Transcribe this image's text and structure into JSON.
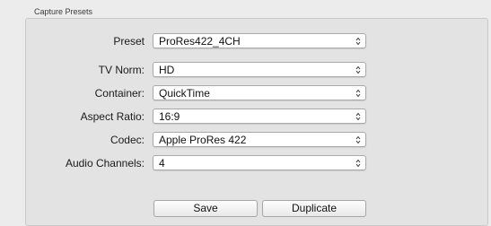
{
  "group_title": "Capture Presets",
  "fields": [
    {
      "label": "Preset",
      "value": "ProRes422_4CH"
    },
    {
      "label": "TV Norm:",
      "value": "HD"
    },
    {
      "label": "Container:",
      "value": "QuickTime"
    },
    {
      "label": "Aspect Ratio:",
      "value": "16:9"
    },
    {
      "label": "Codec:",
      "value": "Apple ProRes 422"
    },
    {
      "label": "Audio Channels:",
      "value": "4"
    }
  ],
  "buttons": {
    "save": "Save",
    "duplicate": "Duplicate"
  },
  "icons": {
    "popup_arrows": "updown-chevron-icon"
  }
}
